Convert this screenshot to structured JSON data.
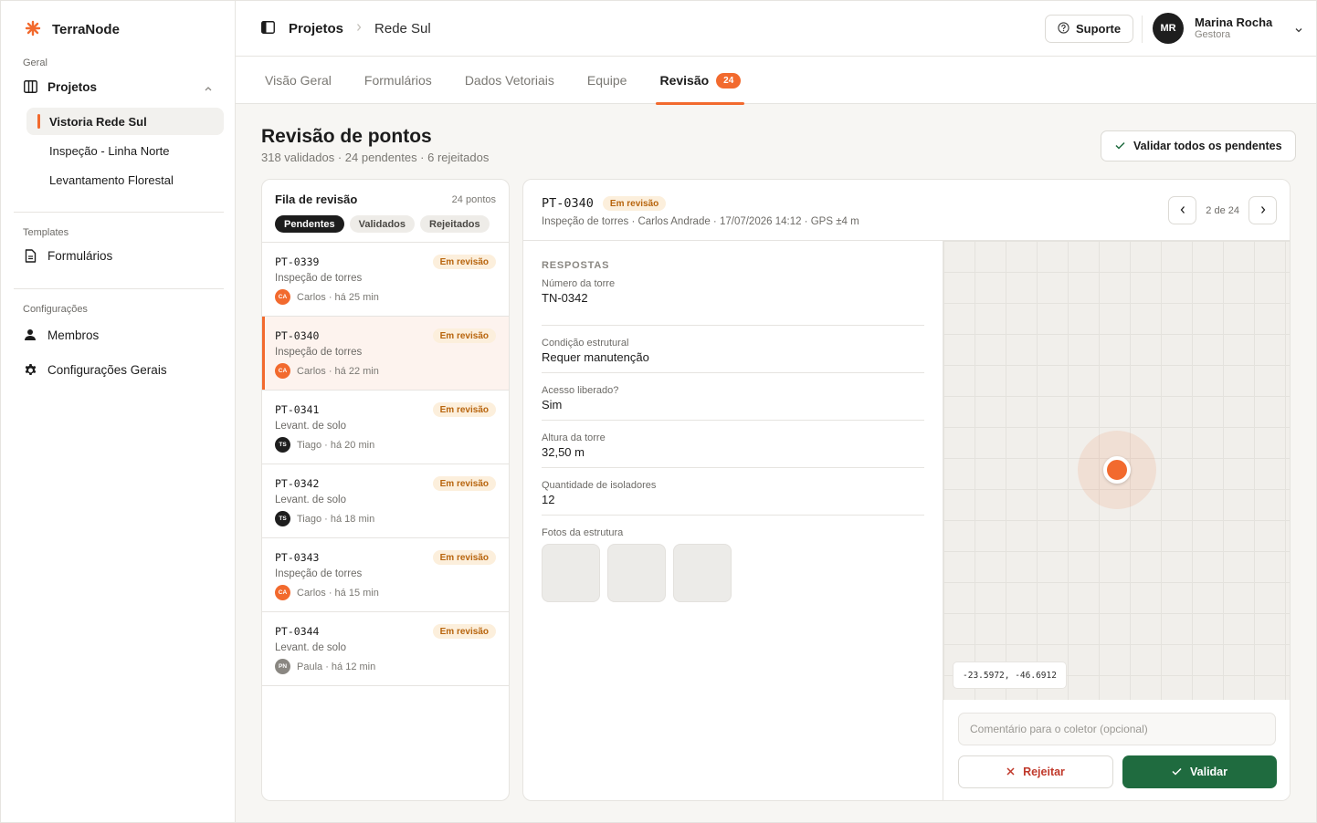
{
  "brand": {
    "name": "TerraNode",
    "accent": "#f26a2e"
  },
  "sidebar": {
    "sections": {
      "geral": "Geral",
      "templates": "Templates",
      "config": "Configurações"
    },
    "projetos_label": "Projetos",
    "projects": [
      "Vistoria Rede Sul",
      "Inspeção - Linha Norte",
      "Levantamento Florestal"
    ],
    "formularios_label": "Formulários",
    "membros_label": "Membros",
    "config_gerais_label": "Configurações Gerais"
  },
  "topbar": {
    "breadcrumb_main": "Projetos",
    "breadcrumb_sub": "Rede Sul",
    "support_label": "Suporte",
    "user": {
      "initials": "MR",
      "name": "Marina Rocha",
      "role": "Gestora"
    }
  },
  "tabs": [
    {
      "label": "Visão Geral"
    },
    {
      "label": "Formulários"
    },
    {
      "label": "Dados Vetoriais"
    },
    {
      "label": "Equipe"
    },
    {
      "label": "Revisão",
      "badge": "24"
    }
  ],
  "page": {
    "title": "Revisão de pontos",
    "subtitle": "318 validados · 24 pendentes · 6 rejeitados",
    "validate_all_label": "Validar todos os pendentes"
  },
  "queue": {
    "title": "Fila de revisão",
    "count": "24 pontos",
    "filters": [
      "Pendentes",
      "Validados",
      "Rejeitados"
    ],
    "items": [
      {
        "id": "PT-0339",
        "status": "Em revisão",
        "type": "Inspeção de torres",
        "initials": "CA",
        "meta": "Carlos · há 25 min",
        "avatar_color": "#f26a2e"
      },
      {
        "id": "PT-0340",
        "status": "Em revisão",
        "type": "Inspeção de torres",
        "initials": "CA",
        "meta": "Carlos · há 22 min",
        "avatar_color": "#f26a2e"
      },
      {
        "id": "PT-0341",
        "status": "Em revisão",
        "type": "Levant. de solo",
        "initials": "TS",
        "meta": "Tiago · há 20 min",
        "avatar_color": "#1e1e1e"
      },
      {
        "id": "PT-0342",
        "status": "Em revisão",
        "type": "Levant. de solo",
        "initials": "TS",
        "meta": "Tiago · há 18 min",
        "avatar_color": "#1e1e1e"
      },
      {
        "id": "PT-0343",
        "status": "Em revisão",
        "type": "Inspeção de torres",
        "initials": "CA",
        "meta": "Carlos · há 15 min",
        "avatar_color": "#f26a2e"
      },
      {
        "id": "PT-0344",
        "status": "Em revisão",
        "type": "Levant. de solo",
        "initials": "PN",
        "meta": "Paula · há 12 min",
        "avatar_color": "#8a8782"
      }
    ]
  },
  "detail": {
    "id": "PT-0340",
    "status": "Em revisão",
    "meta": "Inspeção de torres · Carlos Andrade · 17/07/2026 14:12 · GPS ±4 m",
    "pager": "2 de 24",
    "answers_label": "RESPOSTAS",
    "fields": [
      {
        "label": "Número da torre",
        "value": "TN-0342"
      },
      {
        "label": "Condição estrutural",
        "value": "Requer manutenção"
      },
      {
        "label": "Acesso liberado?",
        "value": "Sim"
      },
      {
        "label": "Altura da torre",
        "value": "32,50 m"
      },
      {
        "label": "Quantidade de isoladores",
        "value": "12"
      }
    ],
    "photos_label": "Fotos da estrutura",
    "coords": "-23.5972, -46.6912",
    "comment_placeholder": "Comentário para o coletor (opcional)",
    "reject_label": "Rejeitar",
    "validate_label": "Validar"
  }
}
